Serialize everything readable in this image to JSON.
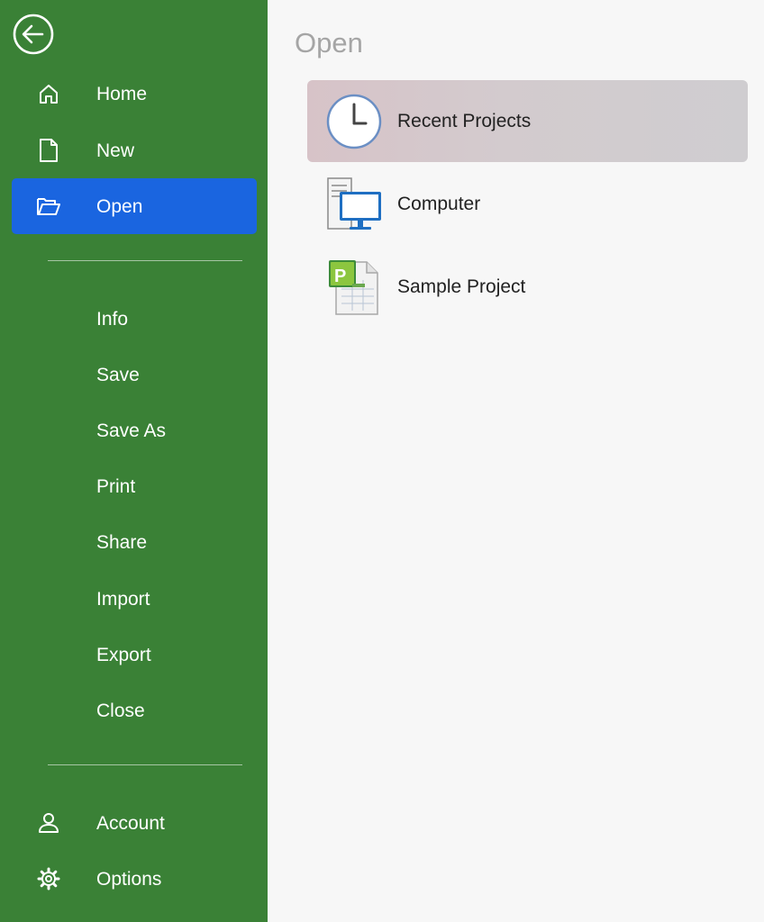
{
  "sidebar": {
    "back_icon": "back-arrow-icon",
    "colors": {
      "background": "#3a8136",
      "active": "#1a65e0",
      "text": "#ffffff"
    },
    "top_items": [
      {
        "label": "Home",
        "icon": "home-icon",
        "active": false
      },
      {
        "label": "New",
        "icon": "new-document-icon",
        "active": false
      },
      {
        "label": "Open",
        "icon": "folder-open-icon",
        "active": true
      }
    ],
    "middle_items": [
      {
        "label": "Info"
      },
      {
        "label": "Save"
      },
      {
        "label": "Save As"
      },
      {
        "label": "Print"
      },
      {
        "label": "Share"
      },
      {
        "label": "Import"
      },
      {
        "label": "Export"
      },
      {
        "label": "Close"
      }
    ],
    "bottom_items": [
      {
        "label": "Account",
        "icon": "person-icon"
      },
      {
        "label": "Options",
        "icon": "gear-icon"
      }
    ]
  },
  "main": {
    "title": "Open",
    "locations": [
      {
        "label": "Recent Projects",
        "icon": "clock-icon",
        "selected": true
      },
      {
        "label": "Computer",
        "icon": "computer-icon",
        "selected": false
      },
      {
        "label": "Sample Project",
        "icon": "project-file-icon",
        "selected": false
      }
    ]
  }
}
